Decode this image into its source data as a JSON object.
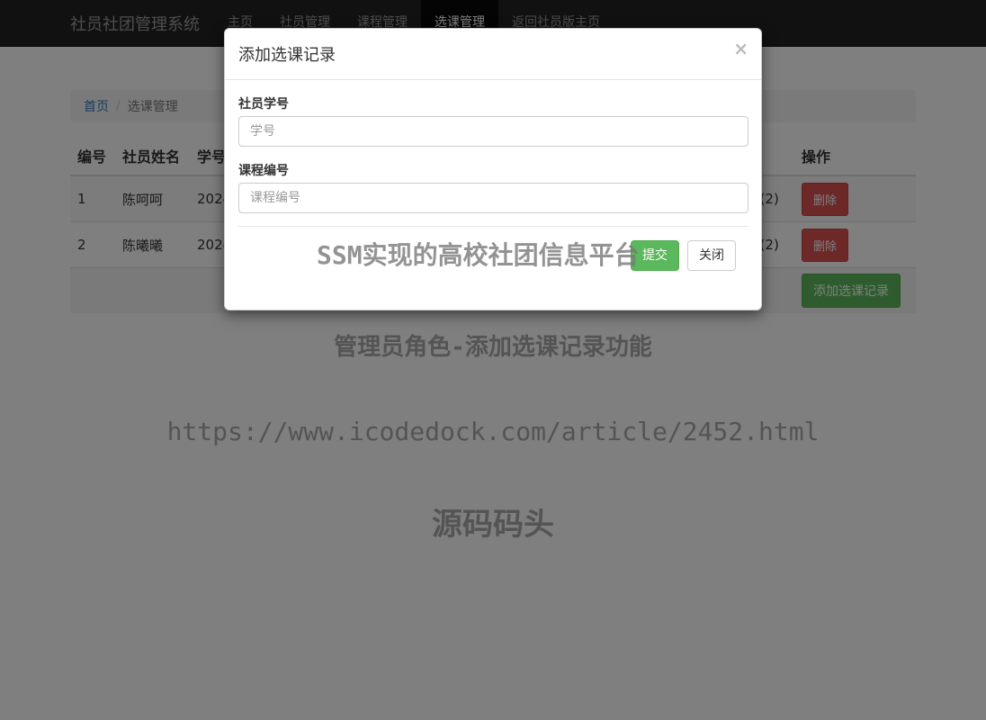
{
  "navbar": {
    "brand": "社员社团管理系统",
    "items": [
      {
        "label": "主页"
      },
      {
        "label": "社员管理"
      },
      {
        "label": "课程管理"
      },
      {
        "label": "选课管理"
      },
      {
        "label": "返回社员版主页"
      }
    ],
    "active_index": 3
  },
  "breadcrumb": {
    "home": "首页",
    "separator": "/",
    "current": "选课管理"
  },
  "table": {
    "headers": {
      "id": "编号",
      "name": "社员姓名",
      "student_no": "学号",
      "action": "操作"
    },
    "rows": [
      {
        "id": "1",
        "name": "陈呵呵",
        "student_no": "2024",
        "course": "5(2)",
        "delete": "删除"
      },
      {
        "id": "2",
        "name": "陈曦曦",
        "student_no": "2024",
        "course": "5(2)",
        "delete": "删除"
      }
    ],
    "add_button": "添加选课记录"
  },
  "modal": {
    "title": "添加选课记录",
    "close_symbol": "×",
    "fields": [
      {
        "label": "社员学号",
        "placeholder": "学号"
      },
      {
        "label": "课程编号",
        "placeholder": "课程编号"
      }
    ],
    "submit": "提交",
    "close": "关闭"
  },
  "watermark": {
    "line1": "SSM实现的高校社团信息平台",
    "line2": "管理员角色-添加选课记录功能",
    "line3": "https://www.icodedock.com/article/2452.html",
    "line4": "源码码头"
  },
  "colors": {
    "navbar_bg": "#222222",
    "primary_link": "#337ab7",
    "danger": "#d9534f",
    "success": "#5cb85c"
  }
}
